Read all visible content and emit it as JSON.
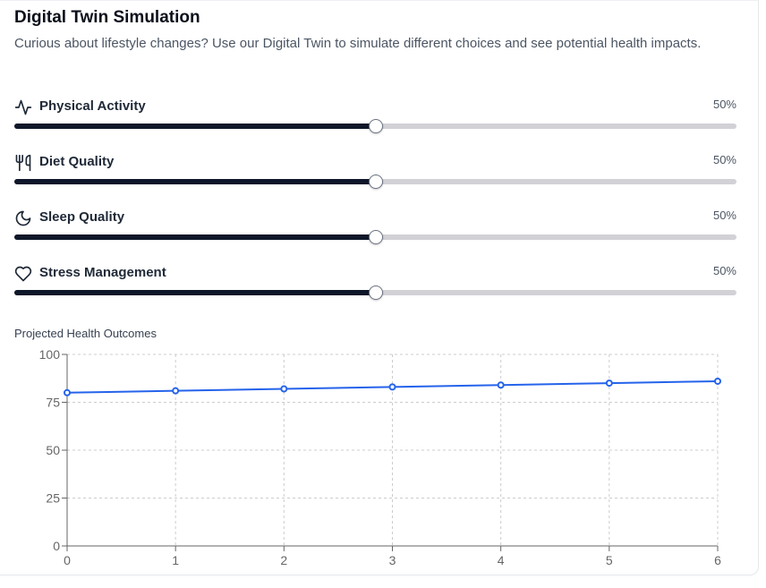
{
  "header": {
    "title": "Digital Twin Simulation",
    "description": "Curious about lifestyle changes? Use our Digital Twin to simulate different choices and see potential health impacts."
  },
  "sliders": [
    {
      "label": "Physical Activity",
      "value_text": "50%",
      "value": 0.5,
      "icon": "activity-icon"
    },
    {
      "label": "Diet Quality",
      "value_text": "50%",
      "value": 0.5,
      "icon": "utensils-icon"
    },
    {
      "label": "Sleep Quality",
      "value_text": "50%",
      "value": 0.5,
      "icon": "moon-icon"
    },
    {
      "label": "Stress Management",
      "value_text": "50%",
      "value": 0.5,
      "icon": "heart-icon"
    }
  ],
  "chart_title": "Projected Health Outcomes",
  "chart_data": {
    "type": "line",
    "title": "Projected Health Outcomes",
    "x": [
      0,
      1,
      2,
      3,
      4,
      5,
      6
    ],
    "series": [
      {
        "values": [
          80,
          81,
          82,
          83,
          84,
          85,
          86
        ],
        "color": "#2563eb"
      }
    ],
    "xticks": [
      "0",
      "1",
      "2",
      "3",
      "4",
      "5",
      "6"
    ],
    "yticks": [
      "0",
      "25",
      "50",
      "75",
      "100"
    ],
    "xlim": [
      0,
      6
    ],
    "ylim": [
      0,
      100
    ],
    "grid": true
  },
  "colors": {
    "slider_fill": "#0f172a",
    "slider_track": "#d1d1d6",
    "line": "#2563eb"
  }
}
